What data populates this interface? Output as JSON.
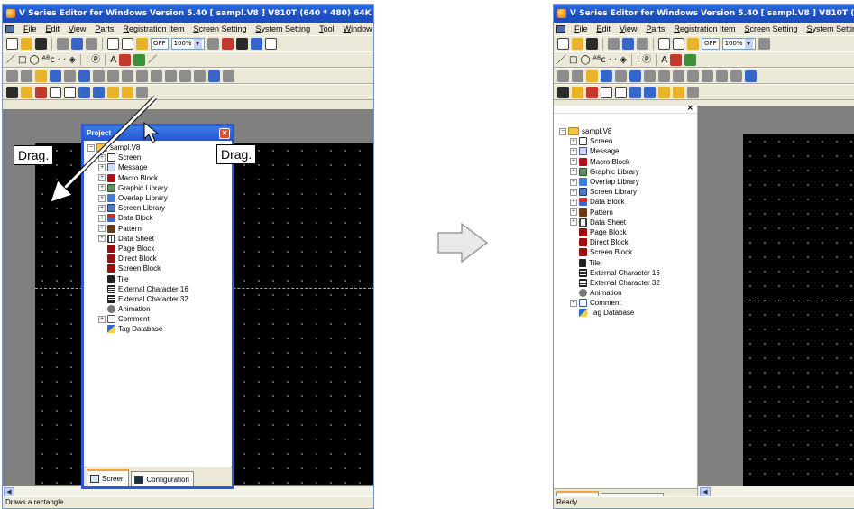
{
  "app": {
    "title": "V Series Editor for Windows Version 5.40 [ sampl.V8 ] V810T (640 * 480) 64K",
    "menus": [
      "File",
      "Edit",
      "View",
      "Parts",
      "Registration Item",
      "Screen Setting",
      "System Setting",
      "Tool",
      "Window"
    ],
    "toolbar": {
      "ovl_state": "OFF",
      "zoom": "100%"
    },
    "colors": {
      "title_bar": "#1b4fc2",
      "editor_background": "#000000",
      "project_frame": "#2c5ad6"
    }
  },
  "project": {
    "title": "Project",
    "root": "sampl.V8",
    "items": [
      {
        "label": "Screen",
        "icon": "screen-icon",
        "expandable": true
      },
      {
        "label": "Message",
        "icon": "message-icon",
        "expandable": true
      },
      {
        "label": "Macro Block",
        "icon": "macro-block-icon",
        "expandable": true
      },
      {
        "label": "Graphic Library",
        "icon": "graphic-library-icon",
        "expandable": true
      },
      {
        "label": "Overlap Library",
        "icon": "overlap-library-icon",
        "expandable": true
      },
      {
        "label": "Screen Library",
        "icon": "screen-library-icon",
        "expandable": true
      },
      {
        "label": "Data Block",
        "icon": "data-block-icon",
        "expandable": true
      },
      {
        "label": "Pattern",
        "icon": "pattern-icon",
        "expandable": true
      },
      {
        "label": "Data Sheet",
        "icon": "data-sheet-icon",
        "expandable": true
      },
      {
        "label": "Page Block",
        "icon": "page-block-icon",
        "expandable": false
      },
      {
        "label": "Direct Block",
        "icon": "direct-block-icon",
        "expandable": false
      },
      {
        "label": "Screen Block",
        "icon": "screen-block-icon",
        "expandable": false
      },
      {
        "label": "Tile",
        "icon": "tile-icon",
        "expandable": false
      },
      {
        "label": "External Character 16",
        "icon": "external-character-16-icon",
        "expandable": false
      },
      {
        "label": "External Character 32",
        "icon": "external-character-32-icon",
        "expandable": false
      },
      {
        "label": "Animation",
        "icon": "animation-icon",
        "expandable": false
      },
      {
        "label": "Comment",
        "icon": "comment-icon",
        "expandable": true
      },
      {
        "label": "Tag Database",
        "icon": "tag-database-icon",
        "expandable": false
      }
    ],
    "tabs": [
      "Screen",
      "Configuration"
    ]
  },
  "left": {
    "status": "Draws a rectangle.",
    "callout_left": "Drag.",
    "callout_right": "Drag."
  },
  "right": {
    "status": "Ready",
    "dock_close": "×"
  }
}
